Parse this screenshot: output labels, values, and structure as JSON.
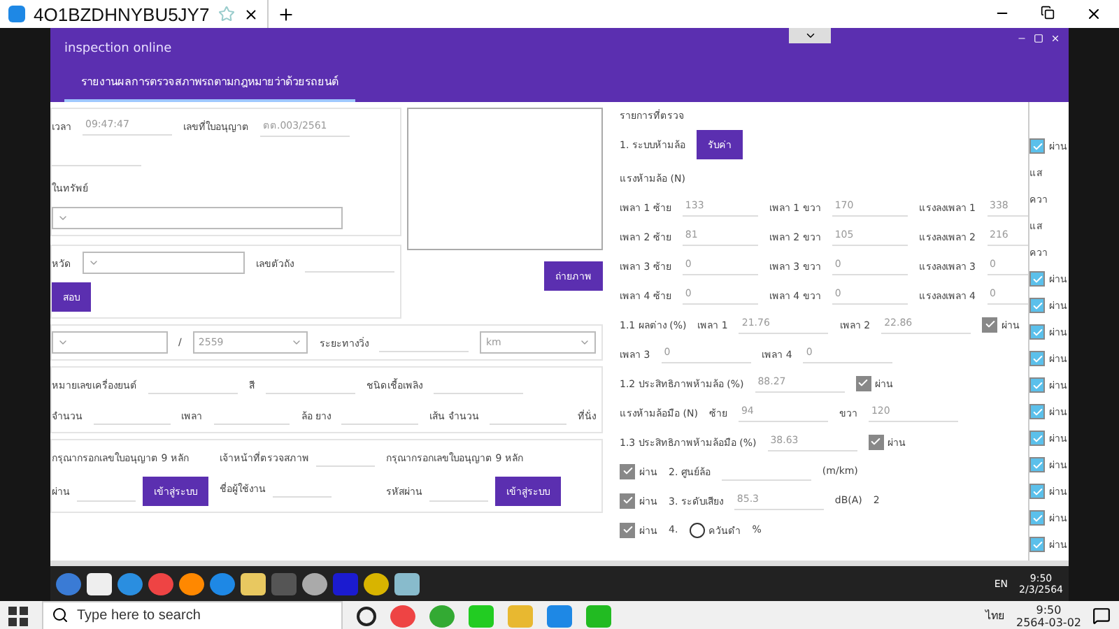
{
  "browser_tab": {
    "title": "4O1BZDHNYBU5JY7"
  },
  "app": {
    "title": "inspection online",
    "tabs": [
      {
        "label": "รายงานผลการตรวจสภาพรถตามกฎหมายว่าด้วยรถยนต์",
        "selected": true
      }
    ]
  },
  "upper_sections": [
    {
      "rows": [
        [
          {
            "kind": "label",
            "text": "เวลา"
          },
          {
            "kind": "field",
            "value": "09:47:47"
          },
          {
            "kind": "label",
            "text": "เลขที่ใบอนุญาต"
          },
          {
            "kind": "field",
            "value": "ตต.003/2561"
          }
        ],
        [
          {
            "kind": "field"
          }
        ],
        [
          {
            "kind": "label",
            "text": "ในทรัพย์"
          }
        ],
        [
          {
            "kind": "select"
          }
        ]
      ]
    },
    {
      "rows": [
        [
          {
            "kind": "label",
            "text": "หวัด"
          },
          {
            "kind": "select"
          },
          {
            "kind": "label",
            "text": "เลขตัวถัง"
          },
          {
            "kind": "field"
          }
        ],
        [
          {
            "kind": "button",
            "text": "สอบ"
          }
        ]
      ]
    }
  ],
  "photo_area": {
    "button": "ถ่ายภาพ"
  },
  "lower_sections": [
    {
      "rows": [
        [
          {
            "kind": "select"
          },
          {
            "kind": "label",
            "text": "/"
          },
          {
            "kind": "select",
            "value": "2559"
          },
          {
            "kind": "label",
            "text": "ระยะทางวิ่ง"
          },
          {
            "kind": "field"
          },
          {
            "kind": "select",
            "value": "km"
          }
        ]
      ]
    },
    {
      "rows": [
        [
          {
            "kind": "label",
            "text": "หมายเลขเครื่องยนต์"
          },
          {
            "kind": "field"
          },
          {
            "kind": "label",
            "text": "สี"
          },
          {
            "kind": "field"
          },
          {
            "kind": "label",
            "text": "ชนิดเชื้อเพลิง"
          },
          {
            "kind": "field"
          }
        ],
        [
          {
            "kind": "label",
            "text": "จำนวน"
          },
          {
            "kind": "field"
          },
          {
            "kind": "label",
            "text": "เพลา"
          },
          {
            "kind": "field"
          },
          {
            "kind": "label",
            "text": "ล้อ ยาง"
          },
          {
            "kind": "field"
          },
          {
            "kind": "label",
            "text": "เส้น จำนวน"
          },
          {
            "kind": "field"
          },
          {
            "kind": "label",
            "text": "ที่นั่ง"
          }
        ]
      ]
    },
    {
      "groups": [
        {
          "rows": [
            [
              {
                "kind": "label",
                "text": "กรุณากรอกเลขใบอนุญาต 9 หลัก"
              }
            ],
            [
              {
                "kind": "label",
                "text": "ผ่าน"
              },
              {
                "kind": "field"
              },
              {
                "kind": "button",
                "text": "เข้าสู่ระบบ"
              }
            ]
          ]
        },
        {
          "rows": [
            [
              {
                "kind": "label",
                "text": "เจ้าหน้าที่ตรวจสภาพ"
              },
              {
                "kind": "field"
              }
            ],
            [
              {
                "kind": "label",
                "text": "ชื่อผู้ใช้งาน"
              },
              {
                "kind": "field"
              }
            ]
          ]
        },
        {
          "rows": [
            [
              {
                "kind": "label",
                "text": "กรุณากรอกเลขใบอนุญาต 9 หลัก"
              }
            ],
            [
              {
                "kind": "label",
                "text": "รหัสผ่าน"
              },
              {
                "kind": "field"
              },
              {
                "kind": "button",
                "text": "เข้าสู่ระบบ"
              }
            ]
          ]
        }
      ]
    }
  ],
  "checklist": {
    "title": "รายการที่ตรวจ",
    "rows": [
      [
        {
          "kind": "label",
          "text": "1. ระบบห้ามล้อ"
        },
        {
          "kind": "button",
          "text": "รับค่า"
        }
      ],
      [
        {
          "kind": "label",
          "text": "แรงห้ามล้อ (N)"
        }
      ],
      [
        {
          "kind": "label",
          "text": "เพลา 1 ซ้าย"
        },
        {
          "kind": "field",
          "value": "133"
        },
        {
          "kind": "label",
          "text": "เพลา 1 ขวา"
        },
        {
          "kind": "field",
          "value": "170"
        },
        {
          "kind": "label",
          "text": "แรงลงเพลา 1"
        },
        {
          "kind": "field",
          "value": "338"
        }
      ],
      [
        {
          "kind": "label",
          "text": "เพลา 2 ซ้าย"
        },
        {
          "kind": "field",
          "value": "81"
        },
        {
          "kind": "label",
          "text": "เพลา 2 ขวา"
        },
        {
          "kind": "field",
          "value": "105"
        },
        {
          "kind": "label",
          "text": "แรงลงเพลา 2"
        },
        {
          "kind": "field",
          "value": "216"
        }
      ],
      [
        {
          "kind": "label",
          "text": "เพลา 3 ซ้าย"
        },
        {
          "kind": "field",
          "value": "0"
        },
        {
          "kind": "label",
          "text": "เพลา 3 ขวา"
        },
        {
          "kind": "field",
          "value": "0"
        },
        {
          "kind": "label",
          "text": "แรงลงเพลา 3"
        },
        {
          "kind": "field",
          "value": "0"
        }
      ],
      [
        {
          "kind": "label",
          "text": "เพลา 4 ซ้าย"
        },
        {
          "kind": "field",
          "value": "0"
        },
        {
          "kind": "label",
          "text": "เพลา 4 ขวา"
        },
        {
          "kind": "field",
          "value": "0"
        },
        {
          "kind": "label",
          "text": "แรงลงเพลา 4"
        },
        {
          "kind": "field",
          "value": "0"
        }
      ],
      [
        {
          "kind": "label",
          "text": "1.1 ผลต่าง (%)"
        },
        {
          "kind": "label",
          "text": "เพลา 1"
        },
        {
          "kind": "field",
          "value": "21.76"
        },
        {
          "kind": "label",
          "text": "เพลา 2"
        },
        {
          "kind": "field",
          "value": "22.86"
        },
        {
          "kind": "check",
          "checked": true,
          "label": "ผ่าน"
        }
      ],
      [
        {
          "kind": "label",
          "text": "เพลา 3"
        },
        {
          "kind": "field",
          "value": "0"
        },
        {
          "kind": "label",
          "text": "เพลา 4"
        },
        {
          "kind": "field",
          "value": "0"
        }
      ],
      [
        {
          "kind": "label",
          "text": "1.2 ประสิทธิภาพห้ามล้อ (%)"
        },
        {
          "kind": "field",
          "value": "88.27"
        },
        {
          "kind": "check",
          "checked": true,
          "label": "ผ่าน"
        }
      ],
      [
        {
          "kind": "label",
          "text": "แรงห้ามล้อมือ (N)"
        },
        {
          "kind": "label",
          "text": "ซ้าย"
        },
        {
          "kind": "field",
          "value": "94"
        },
        {
          "kind": "label",
          "text": "ขวา"
        },
        {
          "kind": "field",
          "value": "120"
        }
      ],
      [
        {
          "kind": "label",
          "text": "1.3 ประสิทธิภาพห้ามล้อมือ (%)"
        },
        {
          "kind": "field",
          "value": "38.63"
        },
        {
          "kind": "check",
          "checked": true,
          "label": "ผ่าน"
        }
      ],
      [
        {
          "kind": "check",
          "checked": true,
          "label": "ผ่าน"
        },
        {
          "kind": "label",
          "text": "2. ศูนย์ล้อ"
        },
        {
          "kind": "field"
        },
        {
          "kind": "label",
          "text": "(m/km)"
        }
      ],
      [
        {
          "kind": "check",
          "checked": true,
          "label": "ผ่าน"
        },
        {
          "kind": "label",
          "text": "3. ระดับเสียง"
        },
        {
          "kind": "field",
          "value": "85.3"
        },
        {
          "kind": "label",
          "text": "dB(A)"
        },
        {
          "kind": "label",
          "text": "2"
        }
      ],
      [
        {
          "kind": "check",
          "checked": true,
          "label": "ผ่าน"
        },
        {
          "kind": "label",
          "text": "4."
        },
        {
          "kind": "radio",
          "selected": false,
          "label": "ควันดำ"
        },
        {
          "kind": "label",
          "text": "%"
        }
      ]
    ]
  },
  "edge_column": [
    {
      "kind": "check",
      "checked": true,
      "label": "ผ่าน"
    },
    {
      "kind": "label",
      "text": "แส"
    },
    {
      "kind": "label",
      "text": "ควา"
    },
    {
      "kind": "label",
      "text": "แส"
    },
    {
      "kind": "label",
      "text": "ควา"
    },
    {
      "kind": "check",
      "checked": true,
      "label": "ผ่าน"
    },
    {
      "kind": "check",
      "checked": true,
      "label": "ผ่าน"
    },
    {
      "kind": "check",
      "checked": true,
      "label": "ผ่าน"
    },
    {
      "kind": "check",
      "checked": true,
      "label": "ผ่าน"
    },
    {
      "kind": "check",
      "checked": true,
      "label": "ผ่าน"
    },
    {
      "kind": "check",
      "checked": true,
      "label": "ผ่าน"
    },
    {
      "kind": "check",
      "checked": true,
      "label": "ผ่าน"
    },
    {
      "kind": "check",
      "checked": true,
      "label": "ผ่าน"
    },
    {
      "kind": "check",
      "checked": true,
      "label": "ผ่าน"
    },
    {
      "kind": "check",
      "checked": true,
      "label": "ผ่าน"
    },
    {
      "kind": "check",
      "checked": true,
      "label": "ผ่าน"
    }
  ],
  "remote_taskbar": {
    "language": "EN",
    "time": "9:50",
    "date": "2/3/2564"
  },
  "taskbar": {
    "search": {
      "placeholder": "Type here to search"
    },
    "language": "ไทย",
    "time": "9:50",
    "date": "2564-03-02"
  }
}
